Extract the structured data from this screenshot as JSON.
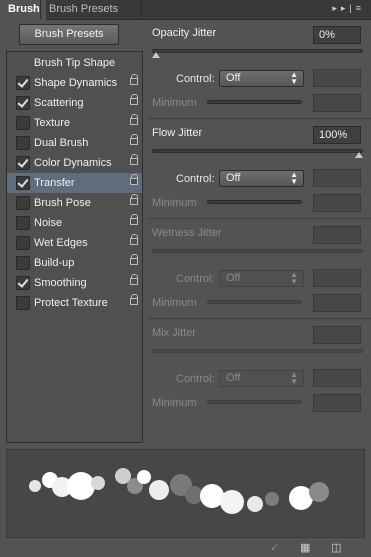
{
  "tabs": [
    {
      "label": "Brush",
      "active": true
    },
    {
      "label": "Brush Presets",
      "active": false
    }
  ],
  "tab_icons": [
    "collapse-icon",
    "panel-menu-icon"
  ],
  "brush_presets_button": "Brush Presets",
  "tip_shape_label": "Brush Tip Shape",
  "options": [
    {
      "label": "Shape Dynamics",
      "checked": true,
      "selected": false
    },
    {
      "label": "Scattering",
      "checked": true,
      "selected": false
    },
    {
      "label": "Texture",
      "checked": false,
      "selected": false
    },
    {
      "label": "Dual Brush",
      "checked": false,
      "selected": false
    },
    {
      "label": "Color Dynamics",
      "checked": true,
      "selected": false
    },
    {
      "label": "Transfer",
      "checked": true,
      "selected": true
    },
    {
      "label": "Brush Pose",
      "checked": false,
      "selected": false
    },
    {
      "label": "Noise",
      "checked": false,
      "selected": false
    },
    {
      "label": "Wet Edges",
      "checked": false,
      "selected": false
    },
    {
      "label": "Build-up",
      "checked": false,
      "selected": false
    },
    {
      "label": "Smoothing",
      "checked": true,
      "selected": false
    },
    {
      "label": "Protect Texture",
      "checked": false,
      "selected": false
    }
  ],
  "jitters": [
    {
      "label": "Opacity Jitter",
      "value": "0%",
      "slider_value": 0,
      "enabled": true,
      "control_label": "Control:",
      "control_value": "Off",
      "minimum_label": "Minimum"
    },
    {
      "label": "Flow Jitter",
      "value": "100%",
      "slider_value": 100,
      "enabled": true,
      "control_label": "Control:",
      "control_value": "Off",
      "minimum_label": "Minimum"
    },
    {
      "label": "Wetness Jitter",
      "value": "",
      "slider_value": null,
      "enabled": false,
      "control_label": "Control:",
      "control_value": "Off",
      "minimum_label": "Minimum"
    },
    {
      "label": "Mix Jitter",
      "value": "",
      "slider_value": null,
      "enabled": false,
      "control_label": "Control:",
      "control_value": "Off",
      "minimum_label": "Minimum"
    }
  ],
  "footer_icons": [
    "toggle-live-tip-icon",
    "grid-icon",
    "new-preset-icon"
  ],
  "colors": {
    "panel": "#535353",
    "selected_row": "#5f6c7b",
    "preview_bg": "#474747"
  }
}
